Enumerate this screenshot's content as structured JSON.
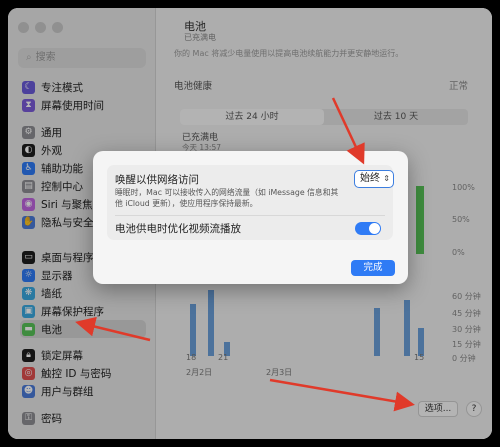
{
  "sidebar": {
    "search_placeholder": "搜索",
    "items": [
      {
        "label": "专注模式",
        "color": "#6a5ad8"
      },
      {
        "label": "屏幕使用时间",
        "color": "#7a5ad8"
      },
      {
        "label": "通用",
        "color": "#8e8e93"
      },
      {
        "label": "外观",
        "color": "#1e1e1e"
      },
      {
        "label": "辅助功能",
        "color": "#2f7bf5"
      },
      {
        "label": "控制中心",
        "color": "#8e8e93"
      },
      {
        "label": "Siri 与聚焦",
        "color": "#c064e0"
      },
      {
        "label": "隐私与安全性",
        "color": "#4a7ad8"
      },
      {
        "label": "桌面与程序坞",
        "color": "#1e1e1e"
      },
      {
        "label": "显示器",
        "color": "#2f7bf5"
      },
      {
        "label": "墙纸",
        "color": "#3aa8e0"
      },
      {
        "label": "屏幕保护程序",
        "color": "#3aa8e0"
      },
      {
        "label": "电池",
        "color": "#58c358"
      },
      {
        "label": "锁定屏幕",
        "color": "#1e1e1e"
      },
      {
        "label": "触控 ID 与密码",
        "color": "#e05050"
      },
      {
        "label": "用户与群组",
        "color": "#4a7ad8"
      },
      {
        "label": "密码",
        "color": "#8e8e93"
      }
    ]
  },
  "main": {
    "title": "电池",
    "subtitle": "已充满电",
    "description": "你的 Mac 将减少电量使用以提高电池续航能力并更安静地运行。",
    "health_label": "电池健康",
    "health_value": "正常",
    "tabs": [
      "过去 24 小时",
      "过去 10 天"
    ],
    "last_charge": "已充满电",
    "today": "今天 13:57",
    "level_axis": [
      "100%",
      "50%",
      "0%"
    ],
    "usage_axis": [
      "60 分钟",
      "45 分钟",
      "30 分钟",
      "15 分钟",
      "0 分钟"
    ],
    "x_ticks": [
      "18",
      "21",
      "15"
    ],
    "dates": [
      "2月2日",
      "2月3日"
    ],
    "options_label": "选项...",
    "help_label": "?"
  },
  "modal": {
    "row1_title": "唤醒以供网络访问",
    "row1_desc": "睡眠时，Mac 可以接收传入的网络流量（如 iMessage 信息和其他 iCloud 更新），使应用程序保持最新。",
    "popup_value": "始终",
    "row2_title": "电池供电时优化视频流播放",
    "row2_toggle": "on",
    "done_label": "完成"
  },
  "colors": {
    "accent": "#2f7bf5",
    "annotation": "#e03a2a",
    "battery_level": "#58c358",
    "usage": "#6a9fd9"
  }
}
